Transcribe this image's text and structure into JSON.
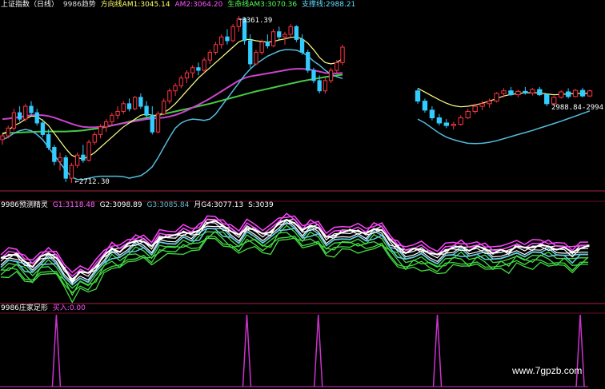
{
  "panels": {
    "main": {
      "title": "上证指数（日线）",
      "indicator": "9986趋势",
      "readouts": [
        {
          "text": "方向线AM1:3045.14",
          "color": "#ffff66"
        },
        {
          "text": "AM2:3064.20",
          "color": "#ff55ff"
        },
        {
          "text": "生命线AM3:3070.36",
          "color": "#55ff55"
        },
        {
          "text": "支撑线:2988.21",
          "color": "#66ddff"
        }
      ]
    },
    "oscillator": {
      "title": "9986预测精灵",
      "readouts": [
        {
          "text": "G1:3118.48",
          "color": "#ff66ff"
        },
        {
          "text": "G2:3098.89",
          "color": "#ffffff"
        },
        {
          "text": "G3:3085.84",
          "color": "#66bbcc"
        },
        {
          "text": "月G4:3077.13",
          "color": "#ffffff"
        },
        {
          "text": "S:3039",
          "color": "#ffffff"
        }
      ]
    },
    "signal": {
      "title": "9986庄家足形",
      "readouts": [
        {
          "text": "买入:0.00",
          "color": "#ff55ff"
        }
      ]
    }
  },
  "watermark": "www.7gpzb.com",
  "chart_data": [
    {
      "type": "candlestick",
      "title": "上证指数（日线）",
      "annotations": [
        "3361.39",
        "2712.30",
        "2988.84-2994.89"
      ],
      "high_label": "3361.39",
      "low_label": "2712.30",
      "ylim": [
        2690,
        3380
      ],
      "colors": {
        "up": "#ff3344",
        "down": "#33ccff",
        "am1": "#ffff88",
        "am2": "#cc44cc",
        "am3": "#44cc44",
        "support": "#55bbdd"
      },
      "segments": [
        {
          "name": "left",
          "candles": [
            {
              "o": 2880,
              "h": 2905,
              "l": 2860,
              "c": 2895
            },
            {
              "o": 2895,
              "h": 2935,
              "l": 2885,
              "c": 2925
            },
            {
              "o": 2925,
              "h": 3000,
              "l": 2915,
              "c": 2985
            },
            {
              "o": 2985,
              "h": 3010,
              "l": 2950,
              "c": 2960
            },
            {
              "o": 2960,
              "h": 3020,
              "l": 2950,
              "c": 3010
            },
            {
              "o": 3010,
              "h": 3030,
              "l": 2975,
              "c": 2985
            },
            {
              "o": 2985,
              "h": 3000,
              "l": 2935,
              "c": 2945
            },
            {
              "o": 2945,
              "h": 2960,
              "l": 2890,
              "c": 2900
            },
            {
              "o": 2900,
              "h": 2920,
              "l": 2840,
              "c": 2850
            },
            {
              "o": 2850,
              "h": 2860,
              "l": 2780,
              "c": 2795
            },
            {
              "o": 2795,
              "h": 2830,
              "l": 2760,
              "c": 2810
            },
            {
              "o": 2810,
              "h": 2820,
              "l": 2715,
              "c": 2730
            },
            {
              "o": 2730,
              "h": 2790,
              "l": 2712,
              "c": 2780
            },
            {
              "o": 2780,
              "h": 2830,
              "l": 2770,
              "c": 2820
            },
            {
              "o": 2820,
              "h": 2860,
              "l": 2790,
              "c": 2800
            },
            {
              "o": 2800,
              "h": 2880,
              "l": 2795,
              "c": 2870
            },
            {
              "o": 2870,
              "h": 2910,
              "l": 2860,
              "c": 2900
            },
            {
              "o": 2900,
              "h": 2940,
              "l": 2885,
              "c": 2930
            },
            {
              "o": 2930,
              "h": 2960,
              "l": 2910,
              "c": 2950
            },
            {
              "o": 2950,
              "h": 2985,
              "l": 2935,
              "c": 2975
            },
            {
              "o": 2975,
              "h": 3010,
              "l": 2960,
              "c": 2990
            },
            {
              "o": 2990,
              "h": 3030,
              "l": 2980,
              "c": 3020
            },
            {
              "o": 3020,
              "h": 3040,
              "l": 2990,
              "c": 3000
            },
            {
              "o": 3000,
              "h": 3050,
              "l": 2995,
              "c": 3045
            },
            {
              "o": 3045,
              "h": 3060,
              "l": 3000,
              "c": 3010
            },
            {
              "o": 3010,
              "h": 3030,
              "l": 2960,
              "c": 2975
            },
            {
              "o": 2975,
              "h": 3010,
              "l": 2900,
              "c": 2910
            },
            {
              "o": 2910,
              "h": 2990,
              "l": 2905,
              "c": 2980
            },
            {
              "o": 2980,
              "h": 3040,
              "l": 2975,
              "c": 3030
            },
            {
              "o": 3030,
              "h": 3080,
              "l": 3020,
              "c": 3070
            },
            {
              "o": 3070,
              "h": 3100,
              "l": 3050,
              "c": 3090
            },
            {
              "o": 3090,
              "h": 3130,
              "l": 3080,
              "c": 3120
            },
            {
              "o": 3120,
              "h": 3150,
              "l": 3100,
              "c": 3140
            },
            {
              "o": 3140,
              "h": 3170,
              "l": 3120,
              "c": 3160
            },
            {
              "o": 3160,
              "h": 3180,
              "l": 3130,
              "c": 3150
            },
            {
              "o": 3150,
              "h": 3200,
              "l": 3140,
              "c": 3190
            },
            {
              "o": 3190,
              "h": 3230,
              "l": 3175,
              "c": 3220
            },
            {
              "o": 3220,
              "h": 3260,
              "l": 3210,
              "c": 3250
            },
            {
              "o": 3250,
              "h": 3290,
              "l": 3235,
              "c": 3280
            },
            {
              "o": 3280,
              "h": 3310,
              "l": 3250,
              "c": 3265
            },
            {
              "o": 3265,
              "h": 3330,
              "l": 3260,
              "c": 3320
            },
            {
              "o": 3320,
              "h": 3361,
              "l": 3300,
              "c": 3350
            },
            {
              "o": 3350,
              "h": 3355,
              "l": 3250,
              "c": 3265
            },
            {
              "o": 3265,
              "h": 3290,
              "l": 3160,
              "c": 3175
            },
            {
              "o": 3175,
              "h": 3230,
              "l": 3170,
              "c": 3220
            },
            {
              "o": 3220,
              "h": 3270,
              "l": 3210,
              "c": 3260
            },
            {
              "o": 3260,
              "h": 3290,
              "l": 3235,
              "c": 3245
            },
            {
              "o": 3245,
              "h": 3310,
              "l": 3240,
              "c": 3300
            },
            {
              "o": 3300,
              "h": 3320,
              "l": 3270,
              "c": 3280
            },
            {
              "o": 3280,
              "h": 3300,
              "l": 3250,
              "c": 3290
            },
            {
              "o": 3290,
              "h": 3330,
              "l": 3280,
              "c": 3320
            },
            {
              "o": 3320,
              "h": 3325,
              "l": 3260,
              "c": 3270
            },
            {
              "o": 3270,
              "h": 3290,
              "l": 3210,
              "c": 3220
            },
            {
              "o": 3220,
              "h": 3230,
              "l": 3140,
              "c": 3150
            },
            {
              "o": 3150,
              "h": 3160,
              "l": 3100,
              "c": 3110
            },
            {
              "o": 3110,
              "h": 3130,
              "l": 3060,
              "c": 3070
            },
            {
              "o": 3070,
              "h": 3120,
              "l": 3060,
              "c": 3110
            },
            {
              "o": 3110,
              "h": 3160,
              "l": 3100,
              "c": 3150
            },
            {
              "o": 3150,
              "h": 3190,
              "l": 3140,
              "c": 3180
            },
            {
              "o": 3180,
              "h": 3250,
              "l": 3170,
              "c": 3240
            }
          ],
          "am1": [
            2900,
            2915,
            2935,
            2945,
            2960,
            2972,
            2970,
            2955,
            2935,
            2905,
            2875,
            2845,
            2820,
            2810,
            2805,
            2815,
            2830,
            2850,
            2870,
            2890,
            2910,
            2930,
            2945,
            2960,
            2975,
            2980,
            2975,
            2975,
            2985,
            3000,
            3020,
            3045,
            3070,
            3095,
            3120,
            3140,
            3160,
            3180,
            3200,
            3220,
            3240,
            3260,
            3270,
            3270,
            3265,
            3262,
            3260,
            3262,
            3268,
            3272,
            3278,
            3280,
            3272,
            3255,
            3230,
            3200,
            3180,
            3175,
            3180,
            3195
          ],
          "am2": [
            2960,
            2962,
            2965,
            2968,
            2972,
            2975,
            2976,
            2975,
            2972,
            2966,
            2958,
            2950,
            2942,
            2935,
            2930,
            2928,
            2928,
            2930,
            2932,
            2936,
            2940,
            2944,
            2948,
            2952,
            2956,
            2960,
            2962,
            2964,
            2966,
            2970,
            2976,
            2984,
            2994,
            3005,
            3016,
            3028,
            3040,
            3054,
            3068,
            3082,
            3096,
            3110,
            3120,
            3126,
            3130,
            3134,
            3138,
            3142,
            3146,
            3150,
            3154,
            3156,
            3156,
            3154,
            3150,
            3145,
            3140,
            3138,
            3138,
            3140
          ],
          "am3": [
            2905,
            2906,
            2907,
            2908,
            2909,
            2910,
            2911,
            2912,
            2912,
            2912,
            2912,
            2912,
            2913,
            2914,
            2916,
            2919,
            2922,
            2926,
            2930,
            2935,
            2940,
            2945,
            2950,
            2955,
            2960,
            2965,
            2970,
            2975,
            2980,
            2985,
            2990,
            2995,
            3000,
            3005,
            3010,
            3015,
            3020,
            3026,
            3032,
            3038,
            3044,
            3050,
            3056,
            3062,
            3068,
            3073,
            3078,
            3083,
            3088,
            3093,
            3098,
            3103,
            3108,
            3112,
            3116,
            3120,
            3124,
            3127,
            3130,
            3133
          ],
          "support": [
            2880,
            2890,
            2905,
            2915,
            2920,
            2915,
            2900,
            2880,
            2850,
            2820,
            2790,
            2760,
            2735,
            2725,
            2725,
            2730,
            2735,
            2738,
            2738,
            2738,
            2738,
            2736,
            2730,
            2735,
            2740,
            2755,
            2775,
            2810,
            2850,
            2890,
            2925,
            2945,
            2955,
            2960,
            2958,
            2955,
            2960,
            2980,
            3010,
            3040,
            3070,
            3100,
            3130,
            3155,
            3175,
            3190,
            3205,
            3215,
            3225,
            3230,
            3230,
            3228,
            3220,
            3205,
            3185,
            3170,
            3150,
            3135,
            3125,
            3118
          ]
        },
        {
          "name": "right",
          "candles": [
            {
              "o": 3070,
              "h": 3080,
              "l": 3020,
              "c": 3030
            },
            {
              "o": 3030,
              "h": 3040,
              "l": 2985,
              "c": 2995
            },
            {
              "o": 2995,
              "h": 3010,
              "l": 2955,
              "c": 2965
            },
            {
              "o": 2965,
              "h": 2980,
              "l": 2935,
              "c": 2945
            },
            {
              "o": 2945,
              "h": 2960,
              "l": 2925,
              "c": 2935
            },
            {
              "o": 2935,
              "h": 2950,
              "l": 2920,
              "c": 2940
            },
            {
              "o": 2940,
              "h": 2975,
              "l": 2935,
              "c": 2965
            },
            {
              "o": 2965,
              "h": 3000,
              "l": 2960,
              "c": 2990
            },
            {
              "o": 2990,
              "h": 3020,
              "l": 2980,
              "c": 3010
            },
            {
              "o": 3010,
              "h": 3030,
              "l": 2995,
              "c": 3020
            },
            {
              "o": 3020,
              "h": 3040,
              "l": 3005,
              "c": 3030
            },
            {
              "o": 3030,
              "h": 3065,
              "l": 3025,
              "c": 3060
            },
            {
              "o": 3060,
              "h": 3080,
              "l": 3045,
              "c": 3070
            },
            {
              "o": 3070,
              "h": 3085,
              "l": 3050,
              "c": 3055
            },
            {
              "o": 3055,
              "h": 3075,
              "l": 3045,
              "c": 3068
            },
            {
              "o": 3068,
              "h": 3085,
              "l": 3055,
              "c": 3062
            },
            {
              "o": 3062,
              "h": 3082,
              "l": 3052,
              "c": 3075
            },
            {
              "o": 3075,
              "h": 3085,
              "l": 3050,
              "c": 3055
            },
            {
              "o": 3055,
              "h": 3060,
              "l": 3010,
              "c": 3020
            },
            {
              "o": 3020,
              "h": 3050,
              "l": 3012,
              "c": 3045
            },
            {
              "o": 3045,
              "h": 3072,
              "l": 3040,
              "c": 3066
            },
            {
              "o": 3066,
              "h": 3080,
              "l": 3040,
              "c": 3048
            },
            {
              "o": 3048,
              "h": 3078,
              "l": 3045,
              "c": 3072
            },
            {
              "o": 3072,
              "h": 3082,
              "l": 3045,
              "c": 3050
            },
            {
              "o": 3050,
              "h": 3075,
              "l": 3046,
              "c": 3070
            }
          ],
          "am1": [
            3080,
            3065,
            3050,
            3035,
            3022,
            3012,
            3008,
            3010,
            3015,
            3022,
            3030,
            3040,
            3050,
            3056,
            3060,
            3062,
            3063,
            3062,
            3058,
            3055,
            3056,
            3058,
            3060,
            3060,
            3061
          ],
          "support": [
            2960,
            2945,
            2925,
            2905,
            2890,
            2880,
            2872,
            2866,
            2865,
            2866,
            2870,
            2876,
            2884,
            2892,
            2900,
            2908,
            2916,
            2925,
            2934,
            2943,
            2952,
            2962,
            2972,
            2982,
            2992
          ]
        }
      ]
    },
    {
      "type": "line",
      "title": "9986预测精灵",
      "series": [
        {
          "name": "G1",
          "color": "#ff44ff"
        },
        {
          "name": "G2",
          "color": "#ffffff"
        },
        {
          "name": "G3",
          "color": "#66ccdd"
        },
        {
          "name": "G4",
          "color": "#ffffff"
        },
        {
          "name": "S",
          "color": "#44dd44"
        }
      ],
      "base": [
        3000,
        3010,
        3015,
        2985,
        2960,
        3005,
        3020,
        3000,
        2955,
        2900,
        2940,
        2935,
        2960,
        3010,
        3040,
        3025,
        3060,
        3075,
        3070,
        3050,
        3085,
        3090,
        3100,
        3110,
        3105,
        3120,
        3150,
        3160,
        3140,
        3115,
        3100,
        3130,
        3120,
        3105,
        3110,
        3150,
        3165,
        3150,
        3120,
        3140,
        3130,
        3090,
        3095,
        3110,
        3120,
        3115,
        3105,
        3125,
        3120,
        3080,
        3050,
        3020,
        3040,
        3035,
        3020,
        3015,
        3030,
        3045,
        3050,
        3030,
        3050,
        3040,
        3020,
        3035,
        3025,
        3050,
        3045,
        3045,
        3055,
        3050,
        3035,
        3045,
        3025,
        3040,
        3052
      ],
      "ylim": [
        2840,
        3220
      ]
    },
    {
      "type": "spike",
      "title": "9986庄家足形",
      "signal_positions": [
        7,
        31,
        40,
        55,
        73
      ],
      "count": 75,
      "color": "#cc33cc"
    }
  ]
}
